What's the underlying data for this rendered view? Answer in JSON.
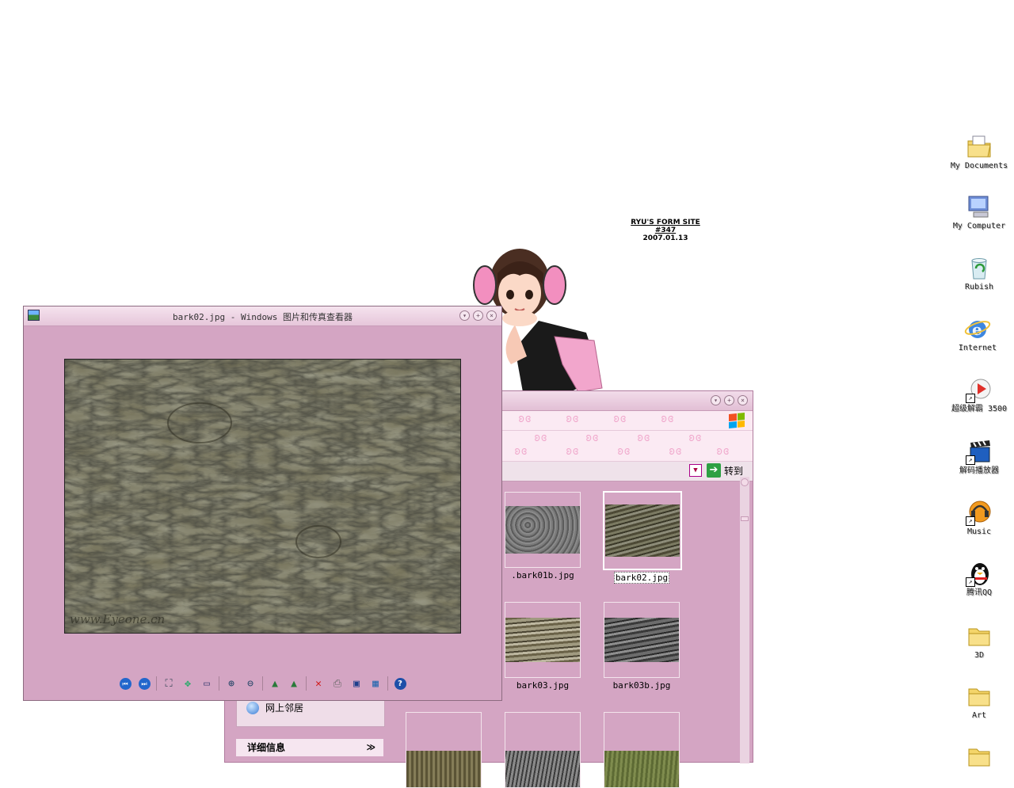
{
  "wallpaper": {
    "credit_line1": "RYU'S FORM SITE #347",
    "credit_line2": "2007.01.13"
  },
  "desktop_icons": [
    {
      "label": "My Documents",
      "icon": "my-documents-icon"
    },
    {
      "label": "My Computer",
      "icon": "my-computer-icon"
    },
    {
      "label": "Rubish",
      "icon": "recycle-bin-icon"
    },
    {
      "label": "Internet",
      "icon": "internet-explorer-icon"
    },
    {
      "label": "超级解霸 3500",
      "icon": "media-player-icon"
    },
    {
      "label": "解码播放器",
      "icon": "clapperboard-icon"
    },
    {
      "label": "Music",
      "icon": "music-icon"
    },
    {
      "label": "腾讯QQ",
      "icon": "qq-penguin-icon"
    },
    {
      "label": "3D",
      "icon": "folder-icon"
    },
    {
      "label": "Art",
      "icon": "folder-icon"
    }
  ],
  "viewer": {
    "title": "bark02.jpg - Windows 图片和传真查看器",
    "watermark": "www.Eyeone.cn",
    "toolbar": [
      "previous-image",
      "next-image",
      "best-fit",
      "actual-size",
      "slideshow",
      "zoom-in",
      "zoom-out",
      "rotate-clockwise",
      "rotate-counterclockwise",
      "delete",
      "print",
      "copy-to",
      "open-for-editing",
      "help"
    ]
  },
  "explorer": {
    "go_label": "转到",
    "task_panel_item": "网上邻居",
    "details_header": "详细信息",
    "thumbnails": [
      {
        "name": ".bark01b.jpg",
        "selected": false
      },
      {
        "name": "bark02.jpg",
        "selected": true
      },
      {
        "name": "bark03.jpg",
        "selected": false
      },
      {
        "name": "bark03b.jpg",
        "selected": false
      }
    ]
  }
}
